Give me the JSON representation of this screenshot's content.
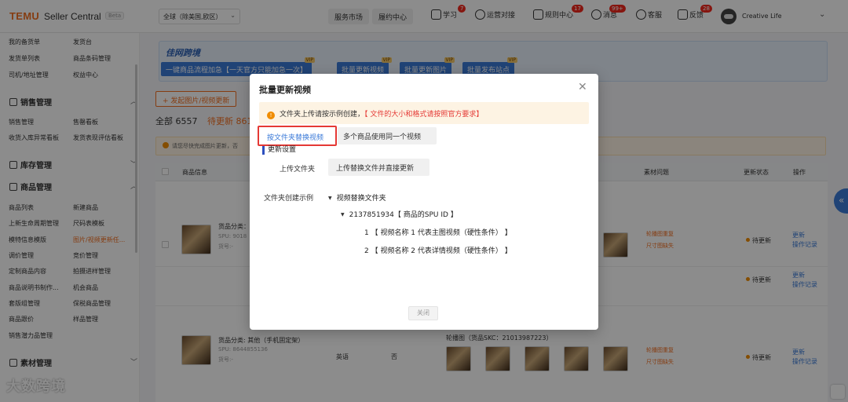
{
  "header": {
    "logo": "TEMU",
    "app_name": "Seller Central",
    "beta": "Beta",
    "region": "全球（除美国,欧区）",
    "nav_buttons": [
      "服务市场",
      "履约中心"
    ],
    "icons": [
      {
        "label": "学习",
        "badge": "7"
      },
      {
        "label": "运营对接",
        "badge": ""
      },
      {
        "label": "规则中心",
        "badge": "17"
      },
      {
        "label": "消息",
        "badge": "99+"
      },
      {
        "label": "客服",
        "badge": ""
      },
      {
        "label": "反馈",
        "badge": "28"
      }
    ],
    "shop_name": "Creative Life"
  },
  "sidebar": {
    "links_top": [
      [
        "我的备货单",
        "发货台"
      ],
      [
        "发货单列表",
        "商品条码管理"
      ],
      [
        "司机/地址管理",
        "权益中心"
      ]
    ],
    "sections": [
      {
        "title": "销售管理",
        "links": [
          [
            "销售管理",
            "售罄看板"
          ],
          [
            "收货入库异常看板",
            "发货表现评估看板"
          ]
        ]
      },
      {
        "title": "库存管理",
        "links": []
      },
      {
        "title": "商品管理",
        "links": [
          [
            "商品列表",
            "新建商品"
          ],
          [
            "上新生命周期管理",
            "尺码表模板"
          ],
          [
            "模特信息模版",
            "图片/视频更新任..."
          ],
          [
            "调价管理",
            "竞价管理"
          ],
          [
            "定制商品内容",
            "拍摄进样管理"
          ],
          [
            "商品说明书制作...",
            "机会商品"
          ],
          [
            "套版组管理",
            "保税商品管理"
          ],
          [
            "商品跟价",
            "样品管理"
          ],
          [
            "销售潜力品管理",
            ""
          ]
        ]
      },
      {
        "title": "素材管理",
        "links": []
      }
    ],
    "watermark": "大数跨境"
  },
  "main": {
    "banner_title": "佳网跨境",
    "banner_buttons": [
      "一键商品流程加急【一天官方只能加急一次】",
      "批量更新视频",
      "批量更新图片",
      "批量发布站点"
    ],
    "vip": "VIP",
    "add_button": "+ 发起图片/视频更新",
    "tab_all": "全部 6557",
    "tab_pending": "待更新 861",
    "tip": "请您尽快完成图片更新，否",
    "columns": [
      "商品信息",
      "素材问题",
      "更新状态",
      "操作"
    ],
    "rows": [
      {
        "category": "货品分类：",
        "spu": "SPU: 9018",
        "code": "货号:-",
        "issues": [
          "轮播图重复",
          "尺寸图缺失"
        ],
        "status": "待更新",
        "ops": [
          "更新",
          "操作记录"
        ]
      },
      {
        "category": "",
        "spu": "",
        "code": "",
        "issues": [],
        "status": "待更新",
        "ops": [
          "更新",
          "操作记录"
        ]
      },
      {
        "category": "货品分类: 其他（手机固定架）",
        "spu": "SPU: 8644855136",
        "code": "货号:-",
        "lang": "英语",
        "flag": "否",
        "carousel": "轮播图（货品SKC：21013987223）",
        "issues": [
          "轮播图重复",
          "尺寸图缺失"
        ],
        "status": "待更新",
        "ops": [
          "更新",
          "操作记录"
        ]
      }
    ]
  },
  "modal": {
    "title": "批量更新视频",
    "alert_prefix": "文件夹上传请按示例创建，",
    "alert_red": "【 文件的大小和格式请按照官方要求】",
    "tab_active": "按文件夹替换视频",
    "tab_other": "多个商品使用同一个视频",
    "section": "更新设置",
    "upload_label": "上传文件夹",
    "upload_choice": "上传替换文件并直接更新",
    "example_label": "文件夹创建示例",
    "tree_root": "视频替换文件夹",
    "tree_spu": "2137851934【 商品的SPU ID 】",
    "tree_item1": "1 【 视频名称 1 代表主图视频（硬性条件） 】",
    "tree_item2": "2 【 视频名称 2 代表详情视频（硬性条件） 】",
    "close_button": "关闭"
  }
}
